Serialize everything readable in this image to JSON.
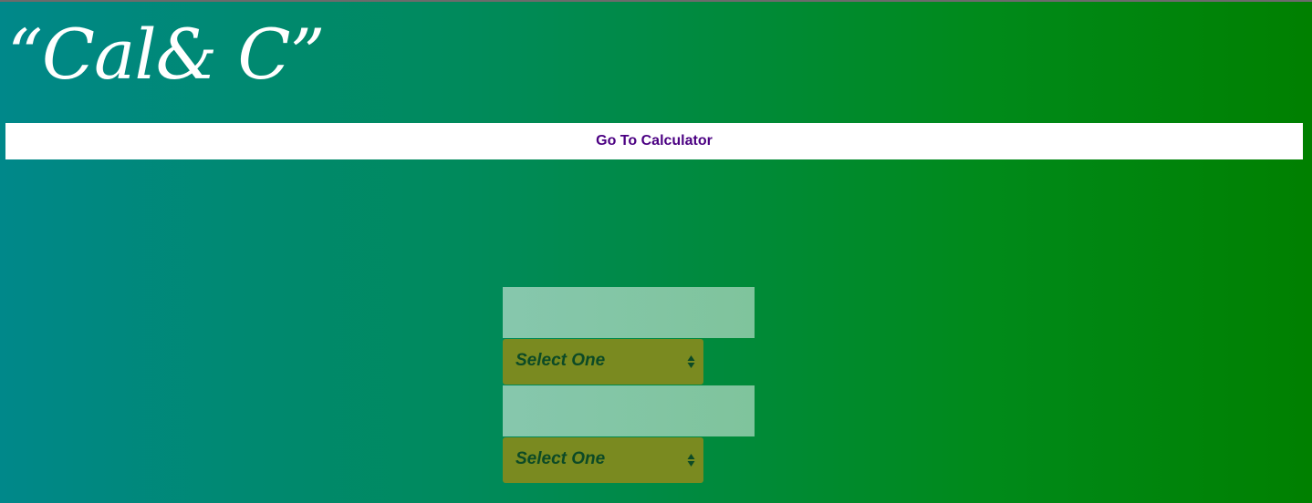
{
  "app": {
    "title": "“Cal& C”"
  },
  "nav": {
    "calculator_link": "Go To Calculator"
  },
  "form": {
    "first_amount": {
      "value": "",
      "placeholder": ""
    },
    "first_unit": {
      "selected": "Select One"
    },
    "second_amount": {
      "value": "",
      "placeholder": ""
    },
    "second_unit": {
      "selected": "Select One"
    }
  },
  "colors": {
    "gradient_left": "#00888a",
    "gradient_right": "#008000",
    "nav_background": "#ffffff",
    "nav_link": "#4b0082",
    "input_background": "#83c6a4",
    "select_background": "#7a8a20",
    "select_text": "#0c4a26"
  },
  "icons": {
    "select_arrows": "updown-triangles-icon"
  }
}
